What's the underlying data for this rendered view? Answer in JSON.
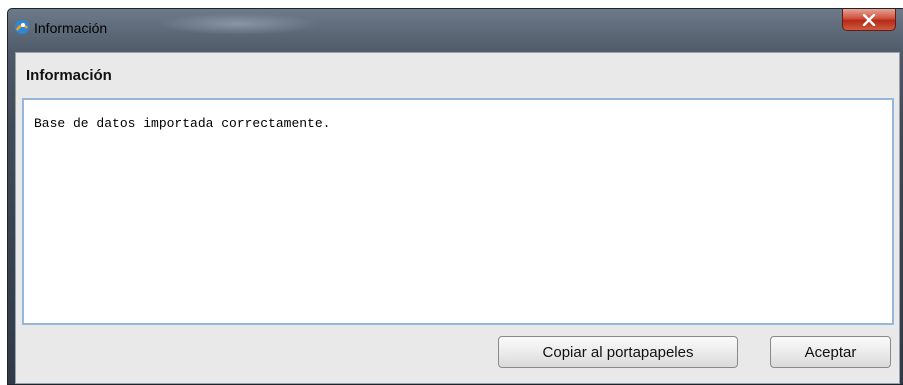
{
  "window": {
    "title": "Información",
    "app_icon": "java-app-icon",
    "close_icon": "close-icon"
  },
  "dialog": {
    "heading": "Información",
    "message": "Base de datos importada correctamente."
  },
  "buttons": {
    "copy_label": "Copiar al portapapeles",
    "ok_label": "Aceptar"
  },
  "colors": {
    "close_button": "#c9412c",
    "message_border": "#98b7d6"
  }
}
